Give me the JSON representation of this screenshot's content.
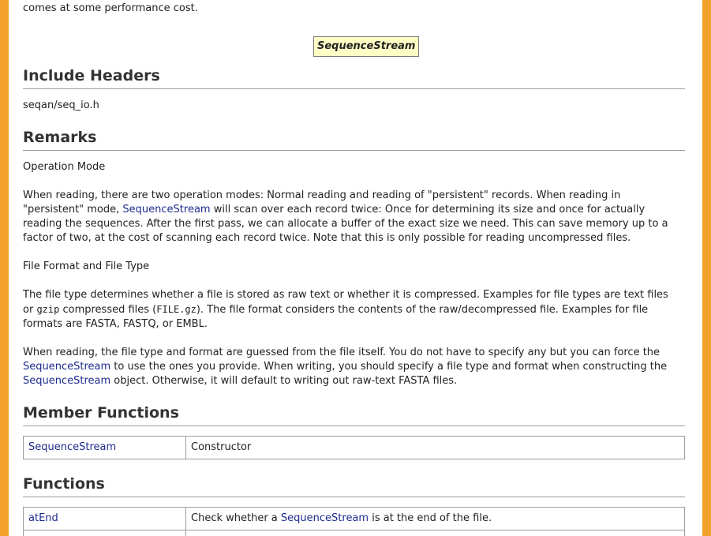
{
  "intro_tail": "comes at some performance cost.",
  "class_diagram": {
    "label": "SequenceStream"
  },
  "sections": {
    "include": {
      "heading": "Include Headers",
      "header_file": "seqan/seq_io.h"
    },
    "remarks": {
      "heading": "Remarks",
      "operation_mode_title": "Operation Mode",
      "operation_mode_text": {
        "part1": "When reading, there are two operation modes: Normal reading and reading of \"persistent\" records. When reading in \"persistent\" mode, ",
        "link": "SequenceStream",
        "part2": " will scan over each record twice: Once for determining its size and once for actually reading the sequences. After the first pass, we can allocate a buffer of the exact size we need. This can save memory up to a factor of two, at the cost of scanning each record twice. Note that this is only possible for reading uncompressed files."
      },
      "file_format_title": "File Format and File Type",
      "file_type_text": {
        "part1": "The file type determines whether a file is stored as raw text or whether it is compressed. Examples for file types are text files or ",
        "code1": "gzip",
        "part2": " compressed files (",
        "code2": "FILE.gz",
        "part3": "). The file format considers the contents of the raw/decompressed file. Examples for file formats are FASTA, FASTQ, or EMBL."
      },
      "guess_text": {
        "part1": "When reading, the file type and format are guessed from the file itself. You do not have to specify any but you can force the ",
        "link1": "SequenceStream",
        "part2": " to use the ones you provide. When writing, you should specify a file type and format when constructing the ",
        "link2": "SequenceStream",
        "part3": " object. Otherwise, it will default to writing out raw-text FASTA files."
      }
    },
    "member_functions": {
      "heading": "Member Functions",
      "rows": [
        {
          "name": "SequenceStream",
          "desc": "Constructor"
        }
      ]
    },
    "functions": {
      "heading": "Functions",
      "rows": [
        {
          "name": "atEnd",
          "desc_part1": "Check whether a ",
          "desc_link": "SequenceStream",
          "desc_part2": " is at the end of the file."
        }
      ]
    }
  },
  "colors": {
    "frame": "#f2a22a",
    "link": "#1d2b8f",
    "diagram_fill": "#ffffc6"
  }
}
